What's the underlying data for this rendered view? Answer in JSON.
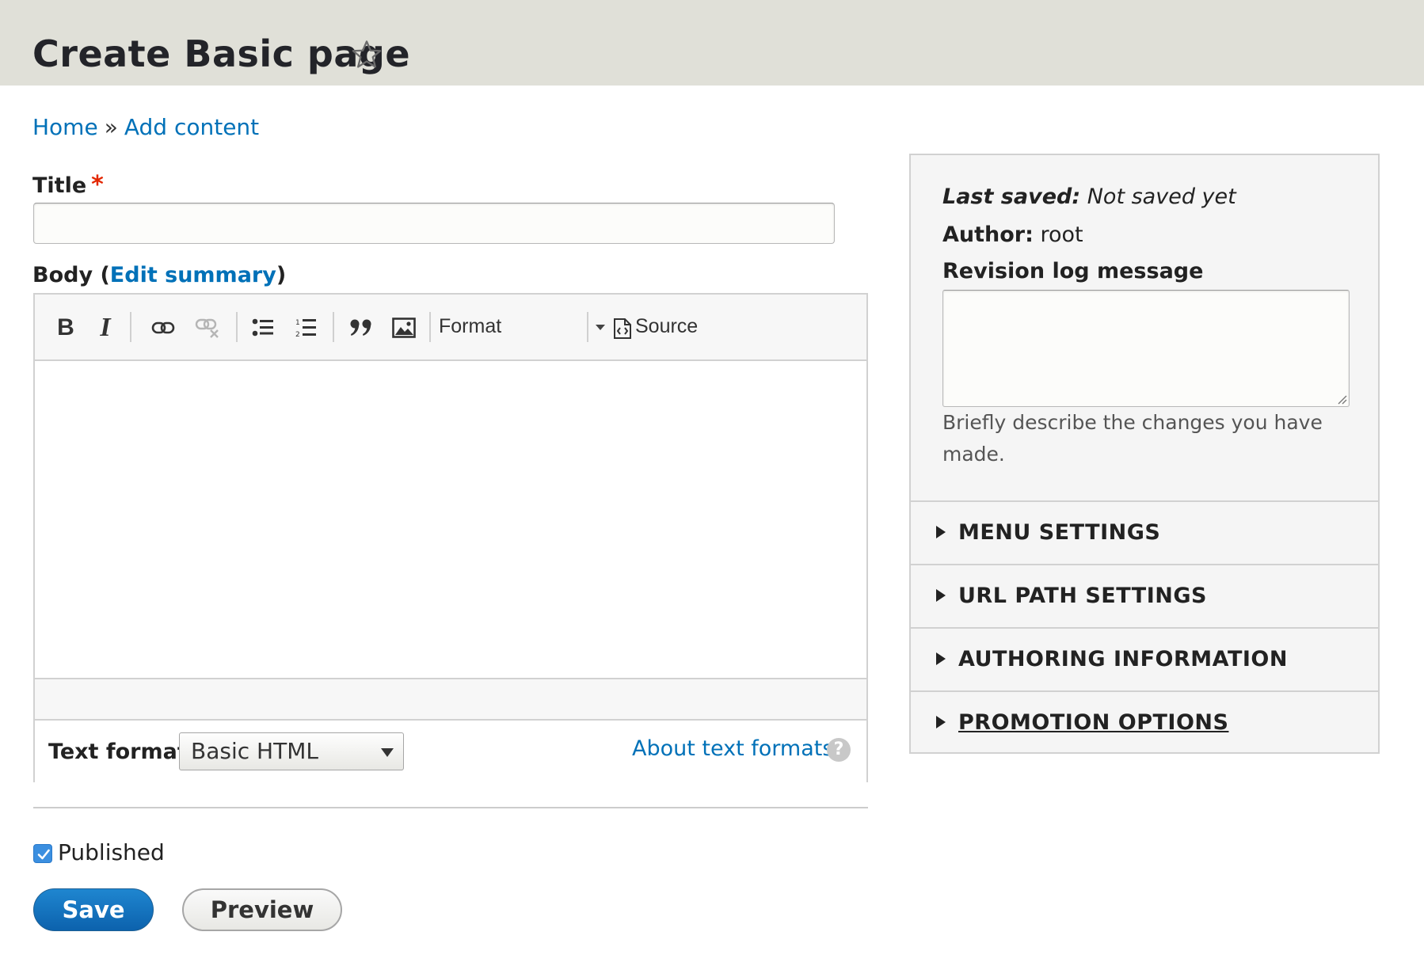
{
  "page": {
    "title": "Create Basic page",
    "star_icon": "star-outline-icon"
  },
  "breadcrumb": {
    "home": "Home",
    "separator": "»",
    "add_content": "Add content"
  },
  "form": {
    "title_label": "Title",
    "required_marker": "*",
    "title_value": "",
    "body_label_prefix": "Body (",
    "body_edit_summary": "Edit summary",
    "body_label_suffix": ")",
    "editor": {
      "toolbar": {
        "bold": "B",
        "italic": "I",
        "link_icon": "link-icon",
        "unlink_icon": "unlink-icon",
        "bulleted_list_icon": "bulleted-list-icon",
        "numbered_list_icon": "numbered-list-icon",
        "blockquote": "❞",
        "image_icon": "image-icon",
        "format_label": "Format",
        "source_label": "Source"
      },
      "text_format_label": "Text format",
      "text_format_value": "Basic HTML",
      "about_text_formats": "About text formats",
      "help_icon": "?"
    },
    "published_label": "Published",
    "published_checked": true,
    "save_label": "Save",
    "preview_label": "Preview"
  },
  "sidebar": {
    "last_saved_label": "Last saved:",
    "last_saved_value": "Not saved yet",
    "author_label": "Author:",
    "author_value": "root",
    "revision_label": "Revision log message",
    "revision_value": "",
    "revision_help": "Briefly describe the changes you have made.",
    "sections": [
      {
        "label": "MENU SETTINGS"
      },
      {
        "label": "URL PATH SETTINGS"
      },
      {
        "label": "AUTHORING INFORMATION"
      },
      {
        "label": "PROMOTION OPTIONS"
      }
    ]
  },
  "colors": {
    "header_bg": "#e0e0d8",
    "link": "#0071b8",
    "primary_button": "#0f6db8",
    "required": "#e32700",
    "checkbox": "#3b8fe0"
  }
}
